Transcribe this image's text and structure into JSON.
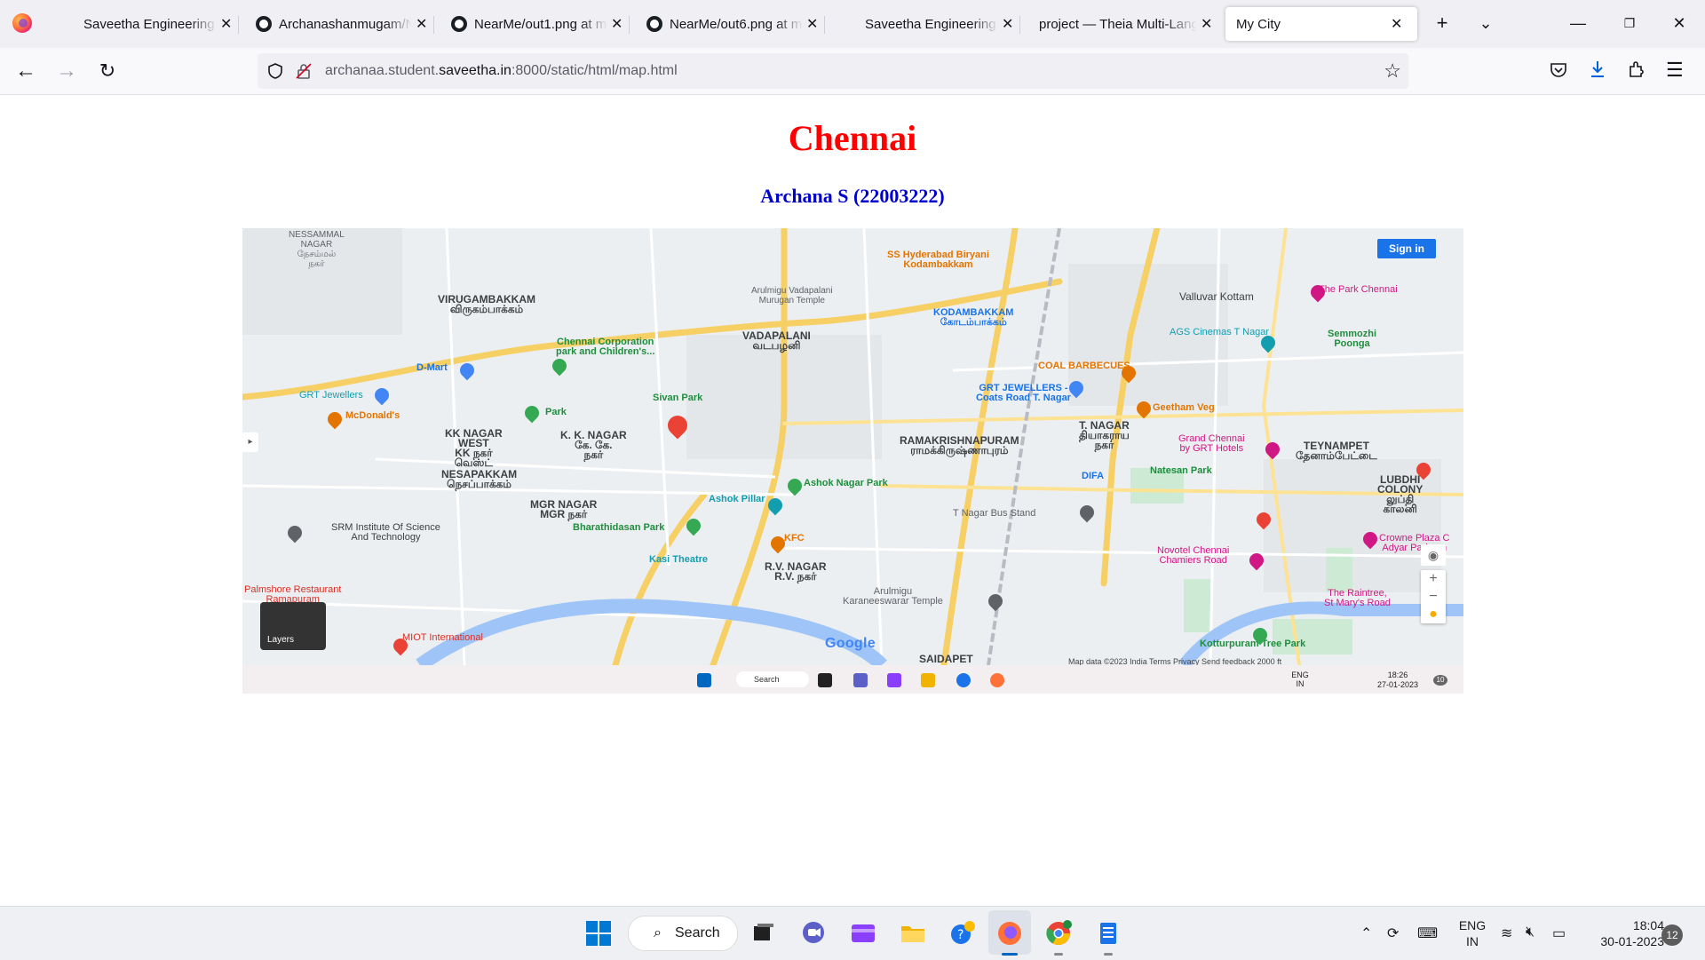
{
  "browser": {
    "tabs": [
      {
        "title": "Saveetha Engineering Colle",
        "icon": "saveetha-icon"
      },
      {
        "title": "Archanashanmugam/N",
        "icon": "github-icon"
      },
      {
        "title": "NearMe/out1.png at m",
        "icon": "github-icon"
      },
      {
        "title": "NearMe/out6.png at m",
        "icon": "github-icon"
      },
      {
        "title": "Saveetha Engineering Colle",
        "icon": "saveetha-icon"
      },
      {
        "title": "project — Theia Multi-Lang",
        "icon": "theia-icon"
      },
      {
        "title": "My City",
        "icon": "none",
        "active": true
      }
    ],
    "new_tab": "+",
    "tab_list": "⌄",
    "url_prefix": "archanaa.student.",
    "url_domain": "saveetha.in",
    "url_suffix": ":8000/static/html/map.html"
  },
  "page": {
    "title": "Chennai",
    "subtitle": "Archana S (22003222)"
  },
  "map": {
    "sign_in": "Sign in",
    "layers": "Layers",
    "google": "Google",
    "attribution": "Map data ©2023    India    Terms    Privacy    Send feedback    2000 ft",
    "labels": {
      "nessammal": "NESSAMMAL\nNAGAR\nநேசம்மல்\nநகர்",
      "virugambakkam": "VIRUGAMBAKKAM\nவிருகம்பாக்கம்",
      "vadapalani": "VADAPALANI\nவடபழனி",
      "kodambakkam": "KODAMBAKKAM\nகோடம்பாக்கம்",
      "valluvar": "Valluvar Kottam",
      "park_chennai": "The Park Chennai",
      "ags": "AGS Cinemas T Nagar",
      "semmozhi": "Semmozhi\nPoonga",
      "murugan": "Arulmigu Vadapalani\nMurugan Temple",
      "corp_park": "Chennai Corporation\npark and Children's...",
      "dmart": "D-Mart",
      "ss_biryani": "SS Hyderabad Biryani\nKodambakkam",
      "coal": "COAL BARBECUES",
      "grt_jewellers": "GRT Jewellers",
      "mcdonalds": "McDonald's",
      "park": "Park",
      "sivan_park": "Sivan Park",
      "kk_nagar_west": "KK NAGAR\nWEST\nKK நகர்\nவெஸ்ட்",
      "kk_nagar": "K. K. NAGAR\nகே. கே.\nநகர்",
      "nesapakkam": "NESAPAKKAM\nநெசப்பாக்கம்",
      "ramakrishnapuram": "RAMAKRISHNAPURAM\nராமக்கிருஷ்ணாபுரம்",
      "grt_tnagar": "GRT JEWELLERS -\nCoats Road T. Nagar",
      "tnagar": "T. NAGAR\nதியாகராய\nநகர்",
      "geetham": "Geetham Veg",
      "grand_chennai": "Grand Chennai\nby GRT Hotels",
      "teynampet": "TEYNAMPET\nதேனாம்பேட்டை",
      "natesan": "Natesan Park",
      "ashok_nagar_park": "Ashok Nagar Park",
      "ashok_pillar": "Ashok Pillar",
      "difa": "DIFA",
      "mgr_nagar": "MGR NAGAR\nMGR நகர்",
      "srm": "SRM Institute Of Science\nAnd Technology",
      "bharathidasan": "Bharathidasan Park",
      "kfc": "KFC",
      "tnagar_bus": "T Nagar Bus Stand",
      "lubdhi": "LUBDHI\nCOLONY\nலுப்தி\nகாலனி",
      "kasi": "Kasi Theatre",
      "rv_nagar": "R.V. NAGAR\nR.V. நகர்",
      "novotel": "Novotel Chennai\nChamiers Road",
      "crowne": "Crowne Plaza C\nAdyar Park, an",
      "palmshore": "Palmshore Restaurant\nRamapuram",
      "miot": "MIOT International",
      "karaneeswarar": "Arulmigu\nKaraneeswarar Temple",
      "raintree": "The Raintree,\nSt Mary's Road",
      "kotturpuram": "Kotturpuram Tree Park",
      "saidapet": "SAIDAPET"
    }
  },
  "inner_taskbar": {
    "search": "Search",
    "lang": "ENG\nIN",
    "time": "18:26",
    "date": "27-01-2023",
    "badge": "10"
  },
  "taskbar": {
    "search": "Search",
    "lang_top": "ENG",
    "lang_bottom": "IN",
    "time": "18:04",
    "date": "30-01-2023",
    "badge": "12"
  }
}
